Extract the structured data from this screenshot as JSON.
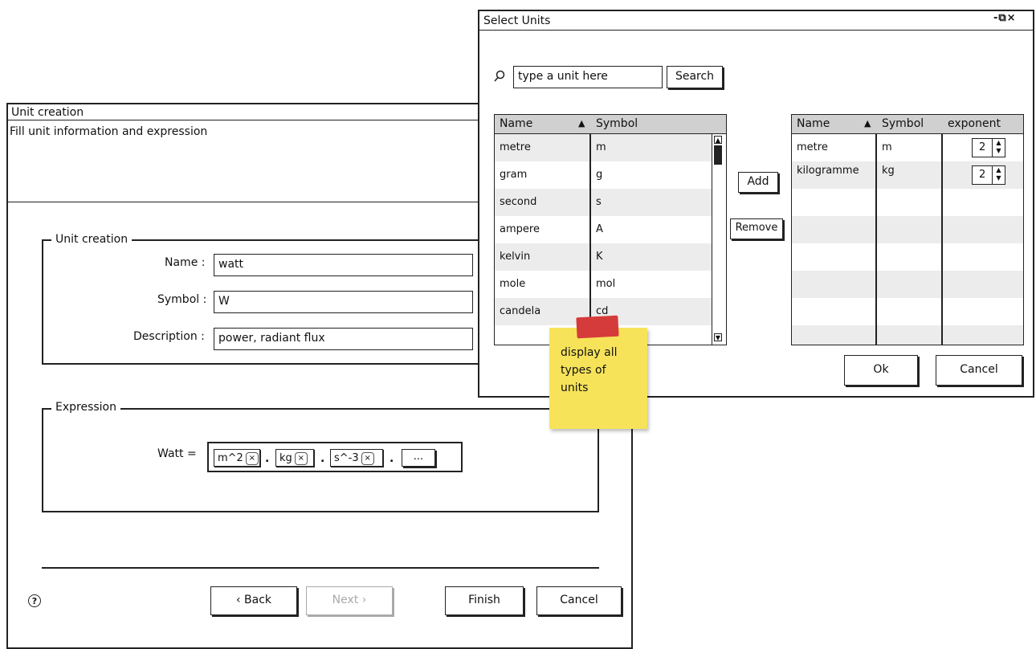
{
  "unit_window": {
    "title": "Unit creation",
    "subtitle": "Fill unit information and expression",
    "unit_group": {
      "legend": "Unit creation",
      "name_label": "Name :",
      "name_value": "watt",
      "symbol_label": "Symbol :",
      "symbol_value": "W",
      "description_label": "Description :",
      "description_value": "power, radiant flux"
    },
    "expression_group": {
      "legend": "Expression",
      "lhs": "Watt =",
      "terms": [
        "m^2",
        "kg",
        "s^-3"
      ],
      "separator": ".",
      "more_label": "..."
    },
    "help_icon": "?",
    "buttons": {
      "back": "‹ Back",
      "next": "Next ›",
      "finish": "Finish",
      "cancel": "Cancel"
    }
  },
  "select_window": {
    "title": "Select Units",
    "controls": "-⧉×",
    "search": {
      "placeholder": "type a unit here",
      "button": "Search"
    },
    "available": {
      "columns": [
        "Name",
        "Symbol"
      ],
      "sort_indicator": "▲",
      "rows": [
        {
          "name": "metre",
          "symbol": "m"
        },
        {
          "name": "gram",
          "symbol": "g"
        },
        {
          "name": "second",
          "symbol": "s"
        },
        {
          "name": "ampere",
          "symbol": "A"
        },
        {
          "name": "kelvin",
          "symbol": "K"
        },
        {
          "name": "mole",
          "symbol": "mol"
        },
        {
          "name": "candela",
          "symbol": "cd"
        }
      ]
    },
    "add_button": "Add",
    "remove_button": "Remove",
    "selected": {
      "columns": [
        "Name",
        "Symbol",
        "exponent"
      ],
      "sort_indicator": "▲",
      "rows": [
        {
          "name": "metre",
          "symbol": "m",
          "exponent": "2"
        },
        {
          "name": "kilogramme",
          "symbol": "kg",
          "exponent": "2"
        }
      ]
    },
    "ok_button": "Ok",
    "cancel_button": "Cancel"
  },
  "sticky_note": {
    "text": "display all types of units",
    "color": "#f7e35a",
    "pin_color": "#d63b3b"
  }
}
